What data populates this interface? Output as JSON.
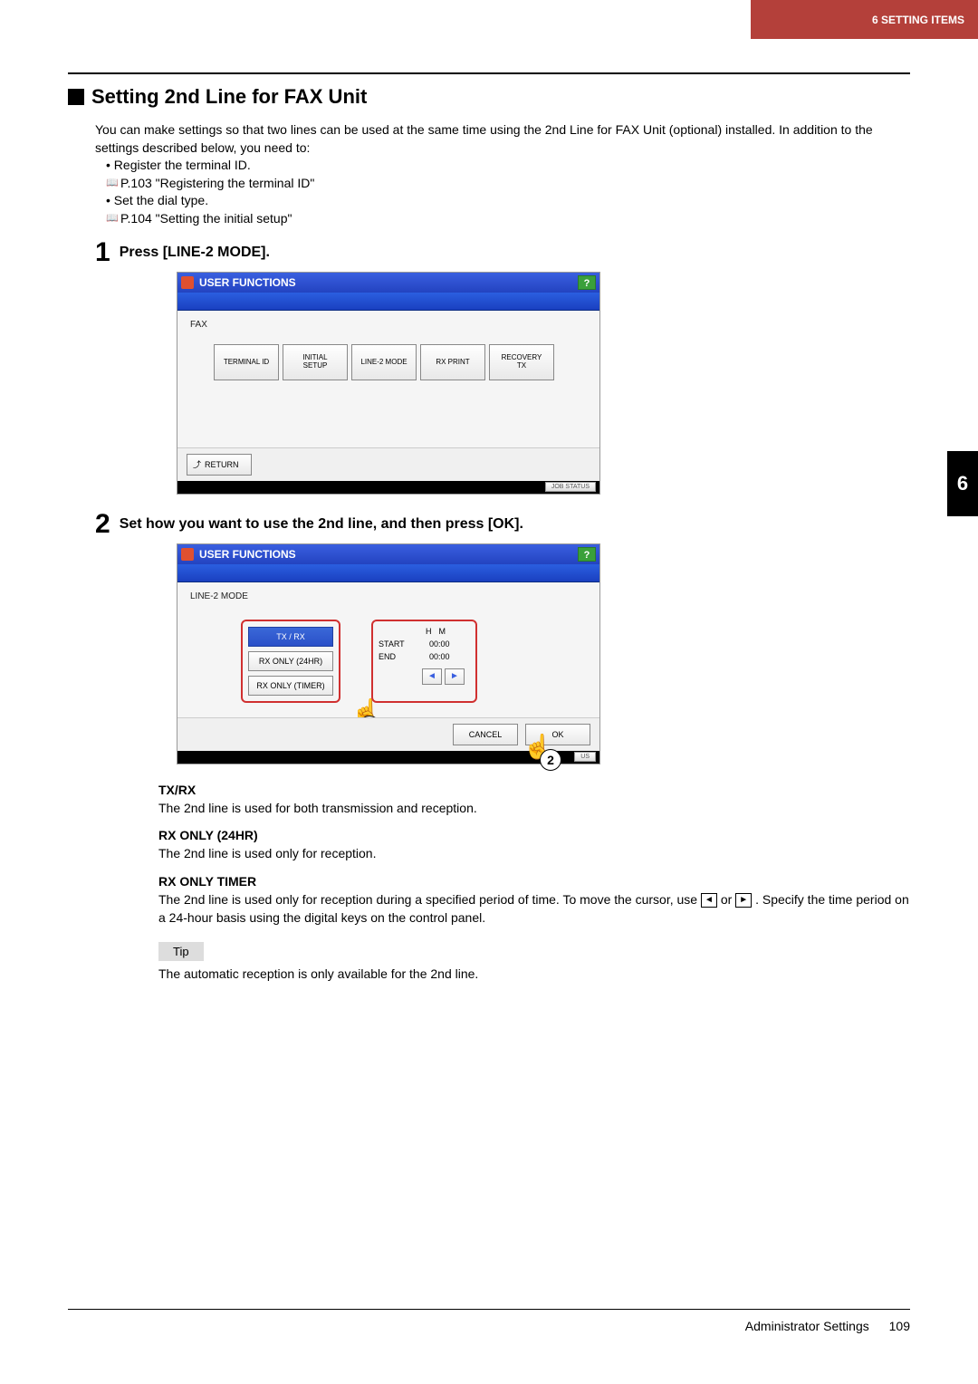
{
  "header": {
    "chapter": "6 SETTING ITEMS"
  },
  "sideTab": "6",
  "section": {
    "title": "Setting 2nd Line for FAX Unit",
    "intro": "You can make settings so that two lines can be used at the same time using the 2nd Line for FAX Unit (optional) installed. In addition to the settings described below, you need to:",
    "bullets": [
      {
        "text": "Register the terminal ID.",
        "ref": "P.103 \"Registering the terminal ID\""
      },
      {
        "text": "Set the dial type.",
        "ref": "P.104 \"Setting the initial setup\""
      }
    ]
  },
  "steps": {
    "s1": {
      "num": "1",
      "title": "Press [LINE-2 MODE]."
    },
    "s2": {
      "num": "2",
      "title": "Set how you want to use the 2nd line, and then press [OK]."
    }
  },
  "device1": {
    "title": "USER FUNCTIONS",
    "help": "?",
    "crumb": "FAX",
    "buttons": {
      "terminalId": "TERMINAL ID",
      "initialSetup1": "INITIAL",
      "initialSetup2": "SETUP",
      "line2mode": "LINE-2 MODE",
      "rxprint": "RX PRINT",
      "recovery1": "RECOVERY",
      "recovery2": "TX"
    },
    "return": "RETURN",
    "jobStatus": "JOB STATUS"
  },
  "device2": {
    "title": "USER FUNCTIONS",
    "help": "?",
    "crumb": "LINE-2 MODE",
    "options": {
      "txrx": "TX / RX",
      "rx24": "RX ONLY (24HR)",
      "rxtimer": "RX ONLY (TIMER)"
    },
    "time": {
      "headH": "H",
      "headM": "M",
      "startLabel": "START",
      "startVal": "00:00",
      "endLabel": "END",
      "endVal": "00:00",
      "leftArrow": "◄",
      "rightArrow": "►"
    },
    "cancel": "CANCEL",
    "ok": "OK",
    "jobStatus": "US"
  },
  "desc": {
    "txrxHead": "TX/RX",
    "txrxBody": "The 2nd line is used for both transmission and reception.",
    "rx24Head": "RX ONLY (24HR)",
    "rx24Body": "The 2nd line is used only for reception.",
    "rxtimerHead": "RX ONLY TIMER",
    "rxtimerBody1": "The 2nd line is used only for reception during a specified period of time. To move the cursor, use ",
    "rxtimerOr": " or ",
    "rxtimerBody2": ". Specify the time period on a 24-hour basis using the digital keys on the control panel."
  },
  "tip": {
    "label": "Tip",
    "text": "The automatic reception is only available for the 2nd line."
  },
  "footer": {
    "label": "Administrator Settings",
    "page": "109"
  }
}
